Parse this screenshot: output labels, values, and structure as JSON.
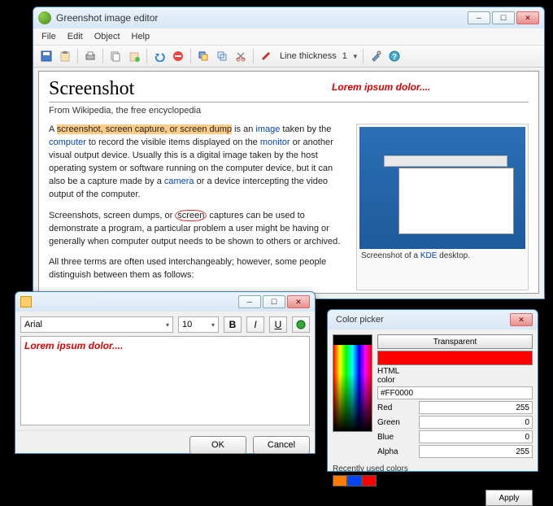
{
  "mainWindow": {
    "title": "Greenshot image editor",
    "menubar": [
      "File",
      "Edit",
      "Object",
      "Help"
    ],
    "toolbar": {
      "lineThicknessLabel": "Line thickness",
      "lineThicknessValue": "1"
    }
  },
  "document": {
    "heading": "Screenshot",
    "subtitle": "From Wikipedia, the free encyclopedia",
    "annotation": "Lorem ipsum dolor....",
    "para1_a": "A ",
    "para1_hl": "screenshot, screen capture, or screen dump",
    "para1_b": " is an ",
    "para1_link1": "image",
    "para1_c": " taken by the ",
    "para1_link2": "computer",
    "para1_d": " to record the visible items displayed on the ",
    "para1_link3": "monitor",
    "para1_e": " or another visual output device. Usually this is a digital image taken by the host operating system or software running on the computer device, but it can also be a capture made by a ",
    "para1_link4": "camera",
    "para1_f": " or a device intercepting the video output of the computer.",
    "para2_a": "Screenshots, screen dumps, or ",
    "para2_circ": "screen",
    "para2_b": " captures can be used to demonstrate a program, a particular problem a user might be having or generally when computer output needs to be shown to others or archived.",
    "para3": "All three terms are often used interchangeably; however, some people distinguish between them as follows:",
    "thumbCaption_a": "Screenshot of a ",
    "thumbCaption_link": "KDE",
    "thumbCaption_b": " desktop."
  },
  "textDialog": {
    "font": "Arial",
    "size": "10",
    "bold": "B",
    "italic": "I",
    "underline": "U",
    "content": "Lorem ipsum dolor....",
    "ok": "OK",
    "cancel": "Cancel"
  },
  "colorPicker": {
    "title": "Color picker",
    "transparent": "Transparent",
    "swatchColor": "#FF0000",
    "htmlLabel": "HTML color",
    "htmlValue": "#FF0000",
    "redLabel": "Red",
    "redValue": "255",
    "greenLabel": "Green",
    "greenValue": "0",
    "blueLabel": "Blue",
    "blueValue": "0",
    "alphaLabel": "Alpha",
    "alphaValue": "255",
    "recentLabel": "Recently used colors",
    "recent": [
      "#ff7a00",
      "#0044ff",
      "#ff0000"
    ],
    "apply": "Apply"
  }
}
